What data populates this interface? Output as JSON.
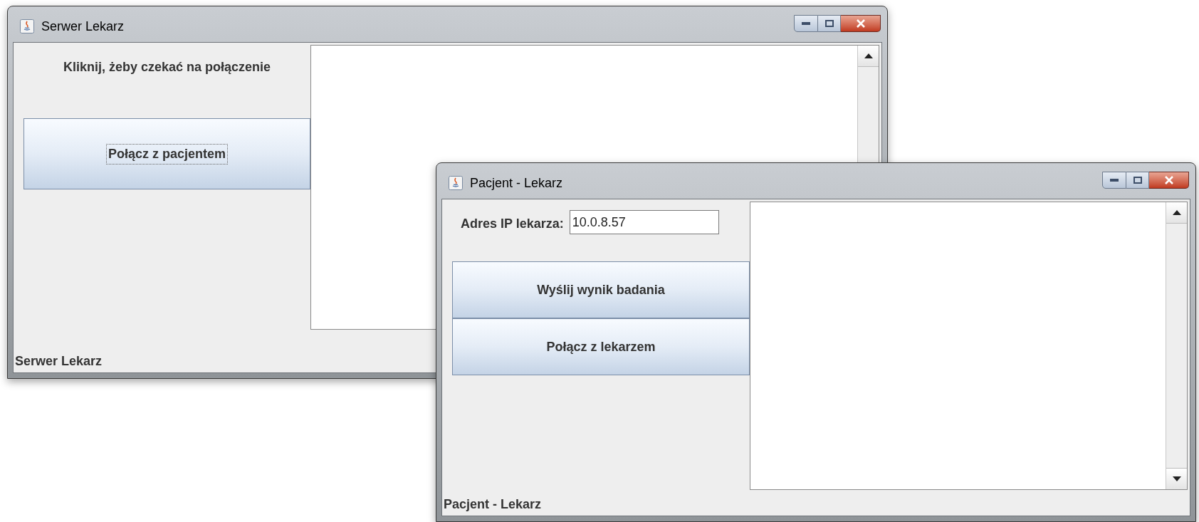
{
  "windows": [
    {
      "title": "Serwer Lekarz",
      "controls": [
        {
          "kind": "label",
          "text": "Kliknij, żeby czekać na połączenie"
        },
        {
          "kind": "button",
          "label": "Połącz z pacjentem",
          "focused": true
        }
      ],
      "status": "Serwer Lekarz"
    },
    {
      "title": "Pacjent - Lekarz",
      "controls": [
        {
          "kind": "field",
          "label": "Adres IP lekarza:",
          "value": "10.0.8.57"
        },
        {
          "kind": "button",
          "label": "Wyślij wynik badania",
          "focused": false
        },
        {
          "kind": "button",
          "label": "Połącz z lekarzem",
          "focused": false
        }
      ],
      "status": "Pacjent - Lekarz"
    }
  ]
}
